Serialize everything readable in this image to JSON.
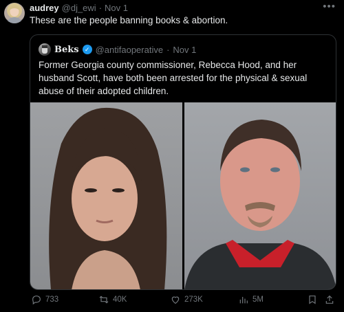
{
  "tweet": {
    "author_name": "audrey",
    "author_handle": "@dj_ewi",
    "separator": "·",
    "time": "Nov 1",
    "text": "These are the people banning books & abortion.",
    "more_icon": "more-icon"
  },
  "quote": {
    "author_name": "Beks",
    "verified_icon": "verified-badge-icon",
    "author_handle": "@antifaoperative",
    "separator": "·",
    "time": "Nov 1",
    "text": "Former Georgia county commissioner, Rebecca Hood, and her husband Scott, have both been arrested for the physical & sexual abuse of their adopted children."
  },
  "actions": {
    "replies": "733",
    "reposts": "40K",
    "likes": "273K",
    "views": "5M"
  },
  "colors": {
    "background": "#000000",
    "text": "#e7e9ea",
    "muted": "#71767b",
    "border": "#2f3336",
    "verified": "#1d9bf0"
  }
}
